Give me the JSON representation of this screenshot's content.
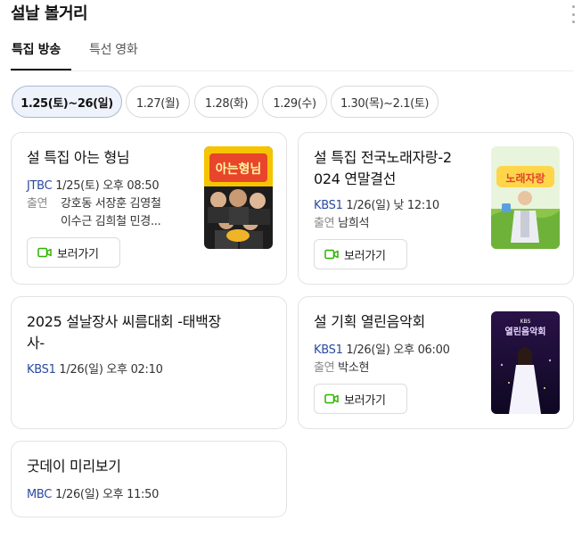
{
  "header": {
    "title": "설날 볼거리"
  },
  "tabs": [
    {
      "label": "특집 방송",
      "active": true
    },
    {
      "label": "특선 영화",
      "active": false
    }
  ],
  "dates": [
    {
      "label": "1.25(토)~26(일)",
      "active": true
    },
    {
      "label": "1.27(월)",
      "active": false
    },
    {
      "label": "1.28(화)",
      "active": false
    },
    {
      "label": "1.29(수)",
      "active": false
    },
    {
      "label": "1.30(목)~2.1(토)",
      "active": false
    }
  ],
  "cast_label": "출연",
  "watch_label": "보러가기",
  "programs": [
    {
      "title": "설 특집 아는 형님",
      "channel": "JTBC",
      "datetime": "1/25(토) 오후 08:50",
      "cast_lines": [
        "강호동 서장훈 김영철",
        "이수근 김희철 민경..."
      ],
      "poster_text": "아는형님"
    },
    {
      "title_lines": [
        "설 특집 전국노래자랑-2",
        "024 연말결선"
      ],
      "channel": "KBS1",
      "datetime": "1/26(일) 낮 12:10",
      "cast_lines": [
        "남희석"
      ],
      "poster_text": "노래자랑"
    },
    {
      "title_lines": [
        "2025 설날장사 씨름대회 -태백장",
        "사-"
      ],
      "channel": "KBS1",
      "datetime": "1/26(일) 오후 02:10"
    },
    {
      "title": "설 기획 열린음악회",
      "channel": "KBS1",
      "datetime": "1/26(일) 오후 06:00",
      "cast_lines": [
        "박소현"
      ],
      "poster_text": "열린음악회",
      "poster_badge": "KBS"
    },
    {
      "title": "굿데이 미리보기",
      "channel": "MBC",
      "datetime": "1/26(일) 오후 11:50"
    }
  ],
  "colors": {
    "channel": "#2b4aa0",
    "chip_active_bg": "#eef2fa",
    "watch_icon": "#2db400"
  }
}
